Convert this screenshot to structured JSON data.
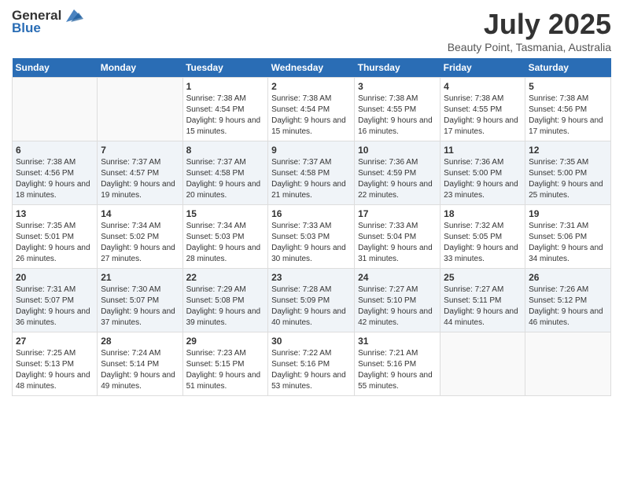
{
  "logo": {
    "general": "General",
    "blue": "Blue"
  },
  "title": "July 2025",
  "subtitle": "Beauty Point, Tasmania, Australia",
  "days_header": [
    "Sunday",
    "Monday",
    "Tuesday",
    "Wednesday",
    "Thursday",
    "Friday",
    "Saturday"
  ],
  "weeks": [
    [
      {
        "day": "",
        "info": ""
      },
      {
        "day": "",
        "info": ""
      },
      {
        "day": "1",
        "info": "Sunrise: 7:38 AM\nSunset: 4:54 PM\nDaylight: 9 hours and 15 minutes."
      },
      {
        "day": "2",
        "info": "Sunrise: 7:38 AM\nSunset: 4:54 PM\nDaylight: 9 hours and 15 minutes."
      },
      {
        "day": "3",
        "info": "Sunrise: 7:38 AM\nSunset: 4:55 PM\nDaylight: 9 hours and 16 minutes."
      },
      {
        "day": "4",
        "info": "Sunrise: 7:38 AM\nSunset: 4:55 PM\nDaylight: 9 hours and 17 minutes."
      },
      {
        "day": "5",
        "info": "Sunrise: 7:38 AM\nSunset: 4:56 PM\nDaylight: 9 hours and 17 minutes."
      }
    ],
    [
      {
        "day": "6",
        "info": "Sunrise: 7:38 AM\nSunset: 4:56 PM\nDaylight: 9 hours and 18 minutes."
      },
      {
        "day": "7",
        "info": "Sunrise: 7:37 AM\nSunset: 4:57 PM\nDaylight: 9 hours and 19 minutes."
      },
      {
        "day": "8",
        "info": "Sunrise: 7:37 AM\nSunset: 4:58 PM\nDaylight: 9 hours and 20 minutes."
      },
      {
        "day": "9",
        "info": "Sunrise: 7:37 AM\nSunset: 4:58 PM\nDaylight: 9 hours and 21 minutes."
      },
      {
        "day": "10",
        "info": "Sunrise: 7:36 AM\nSunset: 4:59 PM\nDaylight: 9 hours and 22 minutes."
      },
      {
        "day": "11",
        "info": "Sunrise: 7:36 AM\nSunset: 5:00 PM\nDaylight: 9 hours and 23 minutes."
      },
      {
        "day": "12",
        "info": "Sunrise: 7:35 AM\nSunset: 5:00 PM\nDaylight: 9 hours and 25 minutes."
      }
    ],
    [
      {
        "day": "13",
        "info": "Sunrise: 7:35 AM\nSunset: 5:01 PM\nDaylight: 9 hours and 26 minutes."
      },
      {
        "day": "14",
        "info": "Sunrise: 7:34 AM\nSunset: 5:02 PM\nDaylight: 9 hours and 27 minutes."
      },
      {
        "day": "15",
        "info": "Sunrise: 7:34 AM\nSunset: 5:03 PM\nDaylight: 9 hours and 28 minutes."
      },
      {
        "day": "16",
        "info": "Sunrise: 7:33 AM\nSunset: 5:03 PM\nDaylight: 9 hours and 30 minutes."
      },
      {
        "day": "17",
        "info": "Sunrise: 7:33 AM\nSunset: 5:04 PM\nDaylight: 9 hours and 31 minutes."
      },
      {
        "day": "18",
        "info": "Sunrise: 7:32 AM\nSunset: 5:05 PM\nDaylight: 9 hours and 33 minutes."
      },
      {
        "day": "19",
        "info": "Sunrise: 7:31 AM\nSunset: 5:06 PM\nDaylight: 9 hours and 34 minutes."
      }
    ],
    [
      {
        "day": "20",
        "info": "Sunrise: 7:31 AM\nSunset: 5:07 PM\nDaylight: 9 hours and 36 minutes."
      },
      {
        "day": "21",
        "info": "Sunrise: 7:30 AM\nSunset: 5:07 PM\nDaylight: 9 hours and 37 minutes."
      },
      {
        "day": "22",
        "info": "Sunrise: 7:29 AM\nSunset: 5:08 PM\nDaylight: 9 hours and 39 minutes."
      },
      {
        "day": "23",
        "info": "Sunrise: 7:28 AM\nSunset: 5:09 PM\nDaylight: 9 hours and 40 minutes."
      },
      {
        "day": "24",
        "info": "Sunrise: 7:27 AM\nSunset: 5:10 PM\nDaylight: 9 hours and 42 minutes."
      },
      {
        "day": "25",
        "info": "Sunrise: 7:27 AM\nSunset: 5:11 PM\nDaylight: 9 hours and 44 minutes."
      },
      {
        "day": "26",
        "info": "Sunrise: 7:26 AM\nSunset: 5:12 PM\nDaylight: 9 hours and 46 minutes."
      }
    ],
    [
      {
        "day": "27",
        "info": "Sunrise: 7:25 AM\nSunset: 5:13 PM\nDaylight: 9 hours and 48 minutes."
      },
      {
        "day": "28",
        "info": "Sunrise: 7:24 AM\nSunset: 5:14 PM\nDaylight: 9 hours and 49 minutes."
      },
      {
        "day": "29",
        "info": "Sunrise: 7:23 AM\nSunset: 5:15 PM\nDaylight: 9 hours and 51 minutes."
      },
      {
        "day": "30",
        "info": "Sunrise: 7:22 AM\nSunset: 5:16 PM\nDaylight: 9 hours and 53 minutes."
      },
      {
        "day": "31",
        "info": "Sunrise: 7:21 AM\nSunset: 5:16 PM\nDaylight: 9 hours and 55 minutes."
      },
      {
        "day": "",
        "info": ""
      },
      {
        "day": "",
        "info": ""
      }
    ]
  ]
}
